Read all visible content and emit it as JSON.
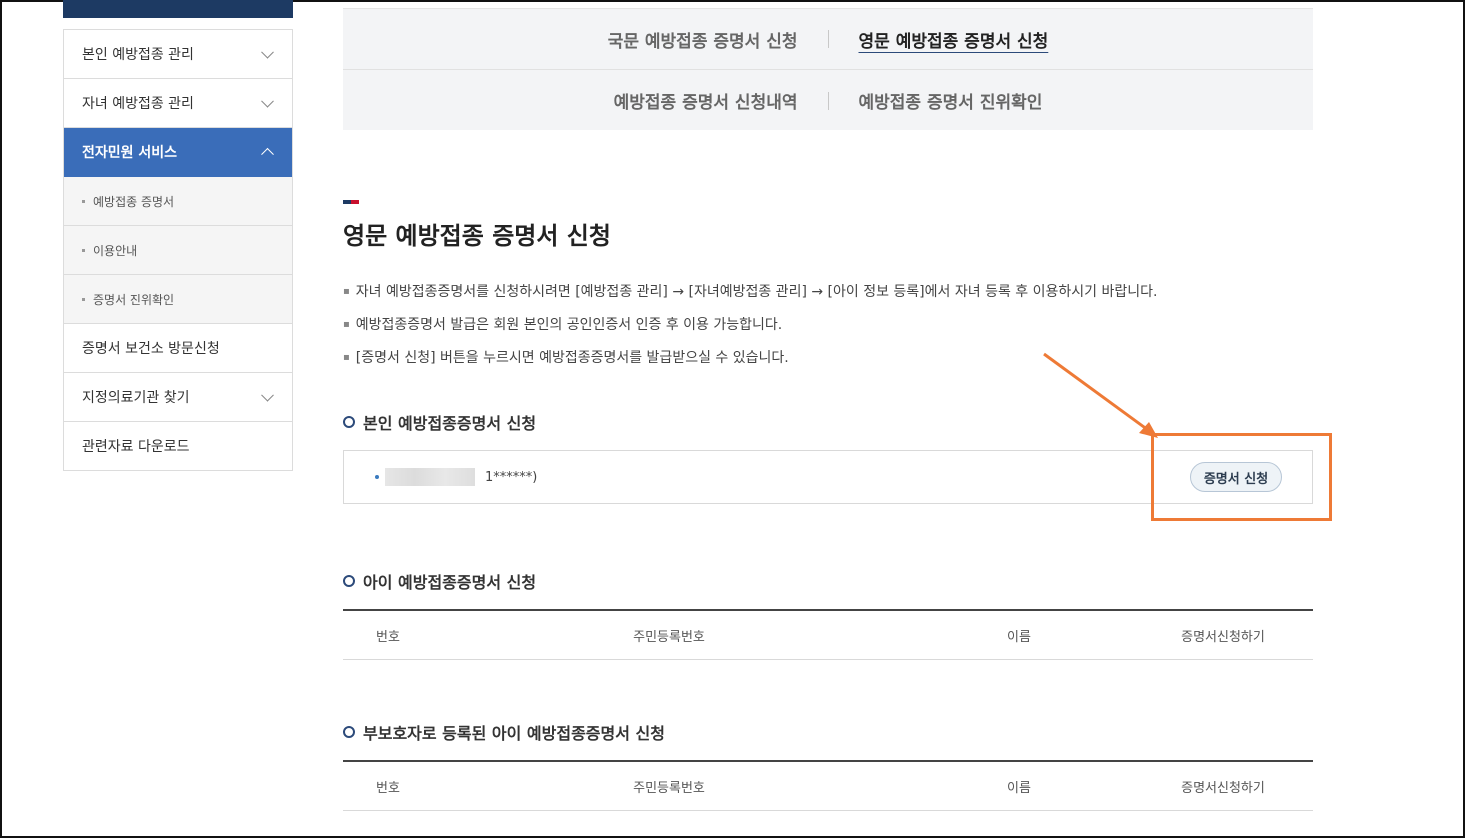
{
  "sidebar": {
    "items": [
      {
        "label": "본인 예방접종 관리"
      },
      {
        "label": "자녀 예방접종 관리"
      },
      {
        "label": "전자민원 서비스"
      },
      {
        "label": "예방접종 증명서"
      },
      {
        "label": "이용안내"
      },
      {
        "label": "증명서 진위확인"
      },
      {
        "label": "증명서 보건소 방문신청"
      },
      {
        "label": "지정의료기관 찾기"
      },
      {
        "label": "관련자료 다운로드"
      }
    ]
  },
  "tabs": {
    "row1": [
      "국문 예방접종 증명서 신청",
      "영문 예방접종 증명서 신청"
    ],
    "row2": [
      "예방접종 증명서 신청내역",
      "예방접종 증명서 진위확인"
    ],
    "active": "영문 예방접종 증명서 신청"
  },
  "page_title": "영문 예방접종 증명서 신청",
  "notes": [
    "자녀 예방접종증명서를 신청하시려면 [예방접종 관리] → [자녀예방접종 관리] → [아이 정보 등록]에서 자녀 등록 후 이용하시기 바랍니다.",
    "예방접종증명서 발급은 회원 본인의 공인인증서 인증 후 이용 가능합니다.",
    "[증명서 신청] 버튼을 누르시면 예방접종증명서를 발급받으실 수 있습니다."
  ],
  "sections": {
    "self": {
      "title": "본인 예방접종증명서 신청",
      "masked_id": "1******)",
      "button": "증명서 신청"
    },
    "child": {
      "title": "아이 예방접종증명서 신청",
      "columns": [
        "번호",
        "주민등록번호",
        "이름",
        "증명서신청하기"
      ]
    },
    "guardian": {
      "title": "부보호자로 등록된 아이 예방접종증명서 신청",
      "columns": [
        "번호",
        "주민등록번호",
        "이름",
        "증명서신청하기"
      ]
    }
  },
  "colors": {
    "accent_blue": "#3a6db9",
    "navy": "#1d3a63",
    "highlight_orange": "#ee7a36",
    "title_mark": [
      "#1d3a63",
      "#c8102e"
    ]
  }
}
